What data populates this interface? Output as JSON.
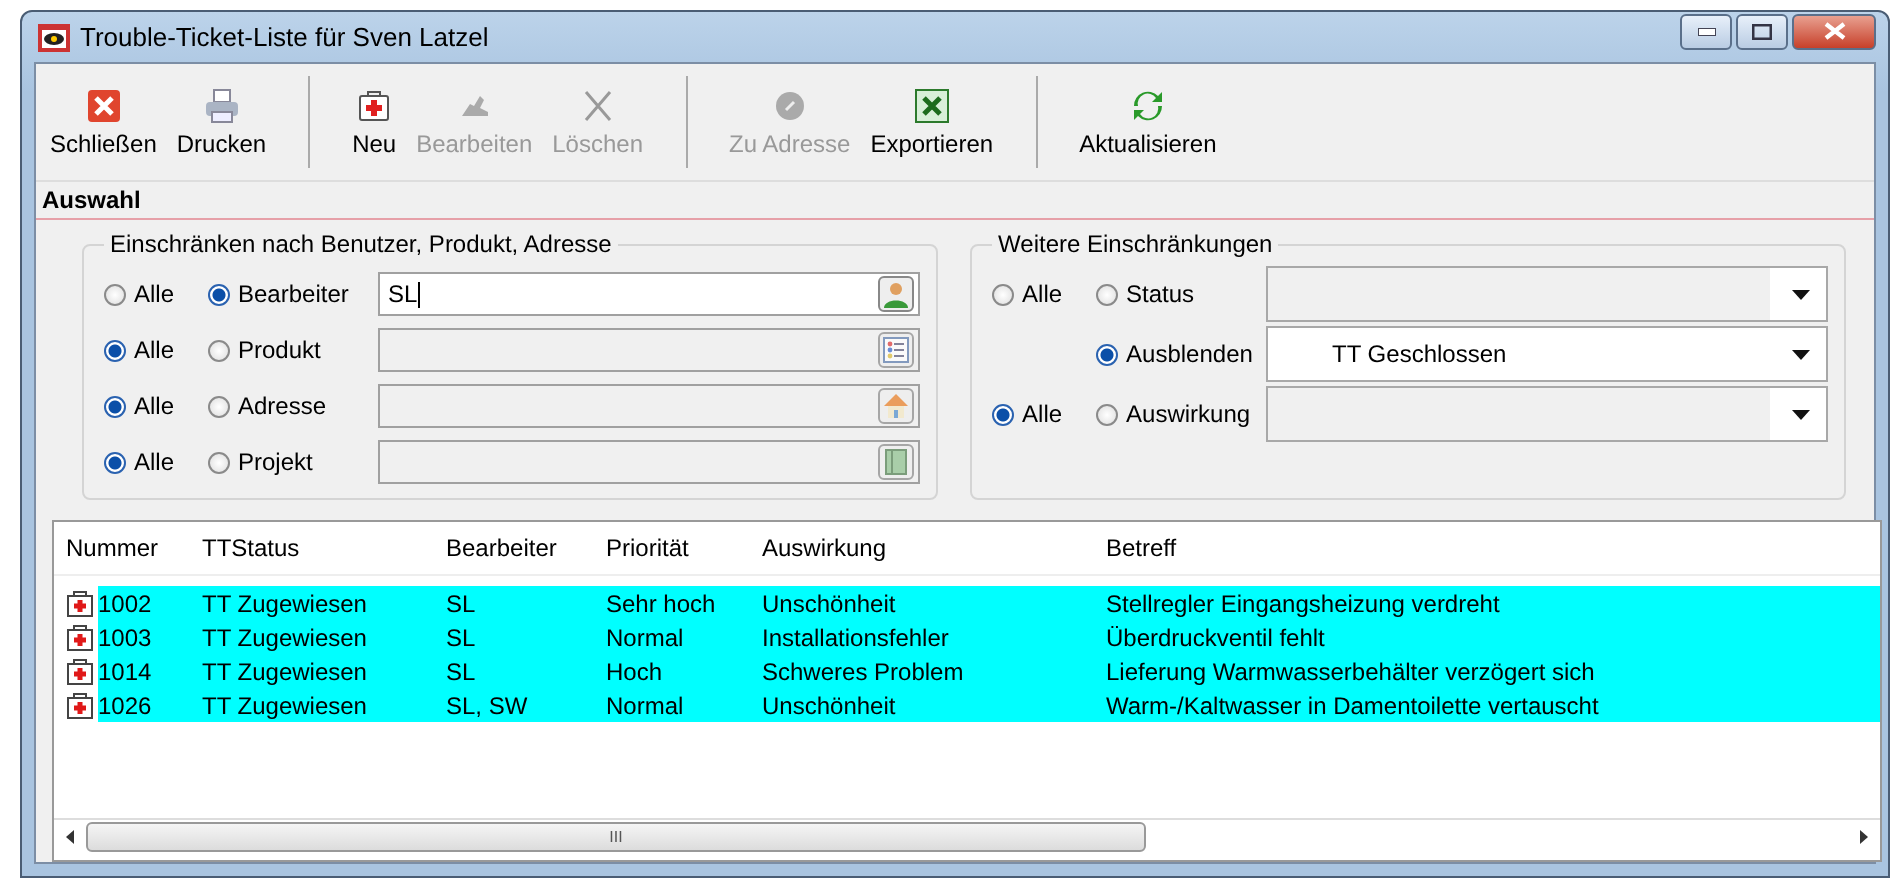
{
  "window": {
    "title": "Trouble-Ticket-Liste für Sven Latzel"
  },
  "toolbar": [
    [
      {
        "label": "Schließen",
        "kind": "close",
        "disabled": false
      },
      {
        "label": "Drucken",
        "kind": "printer",
        "disabled": false
      }
    ],
    [
      {
        "label": "Neu",
        "kind": "new",
        "disabled": false
      },
      {
        "label": "Bearbeiten",
        "kind": "edit",
        "disabled": true
      },
      {
        "label": "Löschen",
        "kind": "delete",
        "disabled": true
      }
    ],
    [
      {
        "label": "Zu Adresse",
        "kind": "address",
        "disabled": true
      },
      {
        "label": "Exportieren",
        "kind": "excel",
        "disabled": false
      }
    ],
    [
      {
        "label": "Aktualisieren",
        "kind": "refresh",
        "disabled": false
      }
    ]
  ],
  "section_title": "Auswahl",
  "left_group": {
    "title": "Einschränken nach Benutzer, Produkt, Adresse",
    "rows": [
      {
        "options": [
          {
            "label": "Alle",
            "selected": false
          },
          {
            "label": "Bearbeiter",
            "selected": true
          }
        ],
        "value": "SL",
        "enabled": true,
        "kind": "person"
      },
      {
        "options": [
          {
            "label": "Alle",
            "selected": true
          },
          {
            "label": "Produkt",
            "selected": false
          }
        ],
        "enabled": false,
        "kind": "list"
      },
      {
        "options": [
          {
            "label": "Alle",
            "selected": true
          },
          {
            "label": "Adresse",
            "selected": false
          }
        ],
        "enabled": false,
        "kind": "house"
      },
      {
        "options": [
          {
            "label": "Alle",
            "selected": true
          },
          {
            "label": "Projekt",
            "selected": false
          }
        ],
        "enabled": false,
        "kind": "book"
      }
    ]
  },
  "right_group": {
    "title": "Weitere Einschränkungen",
    "rows": [
      {
        "options": [
          {
            "label": "Alle",
            "selected": false
          },
          {
            "label": "Status",
            "selected": false
          }
        ],
        "enabled": false
      },
      {
        "options": [
          {
            "label": "Ausblenden",
            "selected": true
          }
        ],
        "value": "TT Geschlossen",
        "enabled": true
      },
      {
        "options": [
          {
            "label": "Alle",
            "selected": true
          },
          {
            "label": "Auswirkung",
            "selected": false
          }
        ],
        "enabled": false
      }
    ]
  },
  "table": {
    "columns": [
      "Nummer",
      "TTStatus",
      "Bearbeiter",
      "Priorität",
      "Auswirkung",
      "Betreff"
    ],
    "rows": [
      {
        "selected": true,
        "cells": [
          "1002",
          "TT Zugewiesen",
          "SL",
          "Sehr hoch",
          "Unschönheit",
          "Stellregler Eingangsheizung verdreht"
        ]
      },
      {
        "selected": true,
        "cells": [
          "1003",
          "TT Zugewiesen",
          "SL",
          "Normal",
          "Installationsfehler",
          "Überdruckventil fehlt"
        ]
      },
      {
        "selected": true,
        "cells": [
          "1014",
          "TT Zugewiesen",
          "SL",
          "Hoch",
          "Schweres Problem",
          "Lieferung Warmwasserbehälter verzögert sich"
        ]
      },
      {
        "selected": true,
        "cells": [
          "1026",
          "TT Zugewiesen",
          "SL, SW",
          "Normal",
          "Unschönheit",
          "Warm-/Kaltwasser in Damentoilette vertauscht"
        ]
      }
    ]
  },
  "scrollbar_grip": "III"
}
